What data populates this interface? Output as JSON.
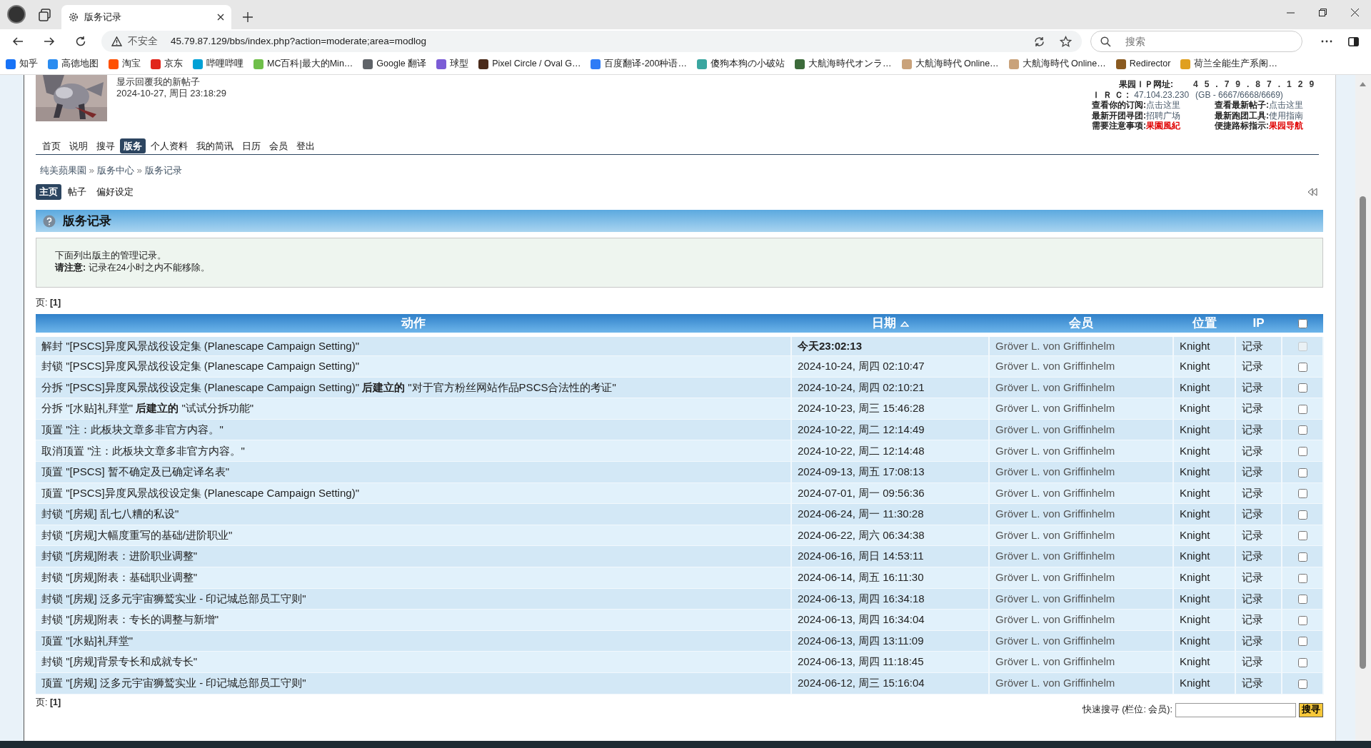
{
  "browser": {
    "tab_title": "版务记录",
    "security_label": "不安全",
    "url": "45.79.87.129/bbs/index.php?action=moderate;area=modlog",
    "search_placeholder": "搜索",
    "bookmarks": [
      {
        "label": "知乎",
        "color": "#1772f6"
      },
      {
        "label": "高德地图",
        "color": "#2a8cf0"
      },
      {
        "label": "淘宝",
        "color": "#ff5000"
      },
      {
        "label": "京东",
        "color": "#e1251b"
      },
      {
        "label": "哔哩哔哩",
        "color": "#00a1d6"
      },
      {
        "label": "MC百科|最大的Min…",
        "color": "#6fbf4a"
      },
      {
        "label": "Google 翻译",
        "color": "#5f6368"
      },
      {
        "label": "球型",
        "color": "#7b5cd6"
      },
      {
        "label": "Pixel Circle / Oval G…",
        "color": "#4a2a1a"
      },
      {
        "label": "百度翻译-200种语…",
        "color": "#2f7cf6"
      },
      {
        "label": "傻狗本狗の小破站",
        "color": "#3aa6a0"
      },
      {
        "label": "大航海時代オンラ…",
        "color": "#3c6b3a"
      },
      {
        "label": "大航海時代 Online…",
        "color": "#c9a27a"
      },
      {
        "label": "大航海時代 Online…",
        "color": "#c9a27a"
      },
      {
        "label": "Redirector",
        "color": "#8a5a20"
      },
      {
        "label": "荷兰全能生产系阁…",
        "color": "#e0a020"
      }
    ]
  },
  "user": {
    "notice": "显示回覆我的新帖子",
    "datetime": "2024-10-27, 周日 23:18:29"
  },
  "site_info": {
    "ip_label": "果园ＩＰ网址:",
    "ip_value": "45.79.87.129",
    "irc_label": "ＩＲＣ:",
    "irc_value": "47.104.23.230",
    "irc_ports": "(GB - 6667/6668/6669)",
    "links": [
      {
        "label": "查看你的订阅:",
        "value": "点击这里",
        "highlight": false
      },
      {
        "label": "查看最新帖子:",
        "value": "点击这里",
        "highlight": false
      },
      {
        "label": "最新开团寻团:",
        "value": "招聘广场",
        "highlight": false
      },
      {
        "label": "最新跑团工具:",
        "value": "使用指南",
        "highlight": false
      },
      {
        "label": "需要注意事项:",
        "value": "果園風紀",
        "highlight": true
      },
      {
        "label": "便捷路标指示:",
        "value": "果园导航",
        "highlight": true
      }
    ]
  },
  "nav": [
    {
      "label": "首页",
      "selected": false
    },
    {
      "label": "说明",
      "selected": false
    },
    {
      "label": "搜寻",
      "selected": false
    },
    {
      "label": "版务",
      "selected": true
    },
    {
      "label": "个人资料",
      "selected": false
    },
    {
      "label": "我的简讯",
      "selected": false
    },
    {
      "label": "日历",
      "selected": false
    },
    {
      "label": "会员",
      "selected": false
    },
    {
      "label": "登出",
      "selected": false
    }
  ],
  "breadcrumb": [
    "纯美蘋果園",
    "版务中心",
    "版务记录"
  ],
  "subnav": [
    {
      "label": "主页",
      "selected": true
    },
    {
      "label": "帖子",
      "selected": false
    },
    {
      "label": "偏好设定",
      "selected": false
    }
  ],
  "title": "版务记录",
  "notice": [
    "下面列出版主的管理记录。",
    "**请注意:** 记录在24小时之内不能移除。"
  ],
  "pages_top": "页: **[1]**",
  "table": {
    "columns": [
      {
        "label": "动作",
        "sorted": false
      },
      {
        "label": "日期",
        "sorted": true
      },
      {
        "label": "会员",
        "sorted": false
      },
      {
        "label": "位置",
        "sorted": false
      },
      {
        "label": "IP",
        "sorted": false
      }
    ],
    "select_all": false,
    "rows": [
      {
        "action": "解封 \"[PSCS]异度风景战役设定集 (Planescape Campaign Setting)\"",
        "date": "今天23:02:13",
        "recent": true,
        "member": "Gröver L. von Griffinhelm",
        "position": "Knight",
        "ip": "记录",
        "checked": false,
        "disabled": true
      },
      {
        "action": "封锁 \"[PSCS]异度风景战役设定集 (Planescape Campaign Setting)\"",
        "date": "2024-10-24, 周四 02:10:47",
        "recent": false,
        "member": "Gröver L. von Griffinhelm",
        "position": "Knight",
        "ip": "记录",
        "checked": false,
        "disabled": false
      },
      {
        "action": "分拆 \"[PSCS]异度风景战役设定集 (Planescape Campaign Setting)\" **后建立的** \"对于官方粉丝网站作品PSCS合法性的考证\"",
        "date": "2024-10-24, 周四 02:10:21",
        "recent": false,
        "member": "Gröver L. von Griffinhelm",
        "position": "Knight",
        "ip": "记录",
        "checked": false,
        "disabled": false
      },
      {
        "action": "分拆 \"[水贴]礼拜堂\" **后建立的** \"试试分拆功能\"",
        "date": "2024-10-23, 周三 15:46:28",
        "recent": false,
        "member": "Gröver L. von Griffinhelm",
        "position": "Knight",
        "ip": "记录",
        "checked": false,
        "disabled": false
      },
      {
        "action": "顶置 \"注：此板块文章多非官方内容。\"",
        "date": "2024-10-22, 周二 12:14:49",
        "recent": false,
        "member": "Gröver L. von Griffinhelm",
        "position": "Knight",
        "ip": "记录",
        "checked": false,
        "disabled": false
      },
      {
        "action": "取消顶置 \"注：此板块文章多非官方内容。\"",
        "date": "2024-10-22, 周二 12:14:48",
        "recent": false,
        "member": "Gröver L. von Griffinhelm",
        "position": "Knight",
        "ip": "记录",
        "checked": false,
        "disabled": false
      },
      {
        "action": "顶置 \"[PSCS] 暂不确定及已确定译名表\"",
        "date": "2024-09-13, 周五 17:08:13",
        "recent": false,
        "member": "Gröver L. von Griffinhelm",
        "position": "Knight",
        "ip": "记录",
        "checked": false,
        "disabled": false
      },
      {
        "action": "顶置 \"[PSCS]异度风景战役设定集 (Planescape Campaign Setting)\"",
        "date": "2024-07-01, 周一 09:56:36",
        "recent": false,
        "member": "Gröver L. von Griffinhelm",
        "position": "Knight",
        "ip": "记录",
        "checked": false,
        "disabled": false
      },
      {
        "action": "封锁 \"[房规] 乱七八糟的私设\"",
        "date": "2024-06-24, 周一 11:30:28",
        "recent": false,
        "member": "Gröver L. von Griffinhelm",
        "position": "Knight",
        "ip": "记录",
        "checked": false,
        "disabled": false
      },
      {
        "action": "封锁 \"[房规]大幅度重写的基础/进阶职业\"",
        "date": "2024-06-22, 周六 06:34:38",
        "recent": false,
        "member": "Gröver L. von Griffinhelm",
        "position": "Knight",
        "ip": "记录",
        "checked": false,
        "disabled": false
      },
      {
        "action": "封锁 \"[房规]附表：进阶职业调整\"",
        "date": "2024-06-16, 周日 14:53:11",
        "recent": false,
        "member": "Gröver L. von Griffinhelm",
        "position": "Knight",
        "ip": "记录",
        "checked": false,
        "disabled": false
      },
      {
        "action": "封锁 \"[房规]附表：基础职业调整\"",
        "date": "2024-06-14, 周五 16:11:30",
        "recent": false,
        "member": "Gröver L. von Griffinhelm",
        "position": "Knight",
        "ip": "记录",
        "checked": false,
        "disabled": false
      },
      {
        "action": "封锁 \"[房规] 泛多元宇宙狮鹫实业 - 印记城总部员工守则\"",
        "date": "2024-06-13, 周四 16:34:18",
        "recent": false,
        "member": "Gröver L. von Griffinhelm",
        "position": "Knight",
        "ip": "记录",
        "checked": false,
        "disabled": false
      },
      {
        "action": "封锁 \"[房规]附表：专长的调整与新增\"",
        "date": "2024-06-13, 周四 16:34:04",
        "recent": false,
        "member": "Gröver L. von Griffinhelm",
        "position": "Knight",
        "ip": "记录",
        "checked": false,
        "disabled": false
      },
      {
        "action": "顶置 \"[水贴]礼拜堂\"",
        "date": "2024-06-13, 周四 13:11:09",
        "recent": false,
        "member": "Gröver L. von Griffinhelm",
        "position": "Knight",
        "ip": "记录",
        "checked": false,
        "disabled": false
      },
      {
        "action": "封锁 \"[房规]背景专长和成就专长\"",
        "date": "2024-06-13, 周四 11:18:45",
        "recent": false,
        "member": "Gröver L. von Griffinhelm",
        "position": "Knight",
        "ip": "记录",
        "checked": false,
        "disabled": false
      },
      {
        "action": "顶置 \"[房规] 泛多元宇宙狮鹫实业 - 印记城总部员工守则\"",
        "date": "2024-06-12, 周三 15:16:04",
        "recent": false,
        "member": "Gröver L. von Griffinhelm",
        "position": "Knight",
        "ip": "记录",
        "checked": false,
        "disabled": false
      }
    ]
  },
  "pages_bottom": "页: **[1]**",
  "quick_search": {
    "label": "快速搜寻 (栏位: 会员):",
    "button": "搜寻"
  }
}
